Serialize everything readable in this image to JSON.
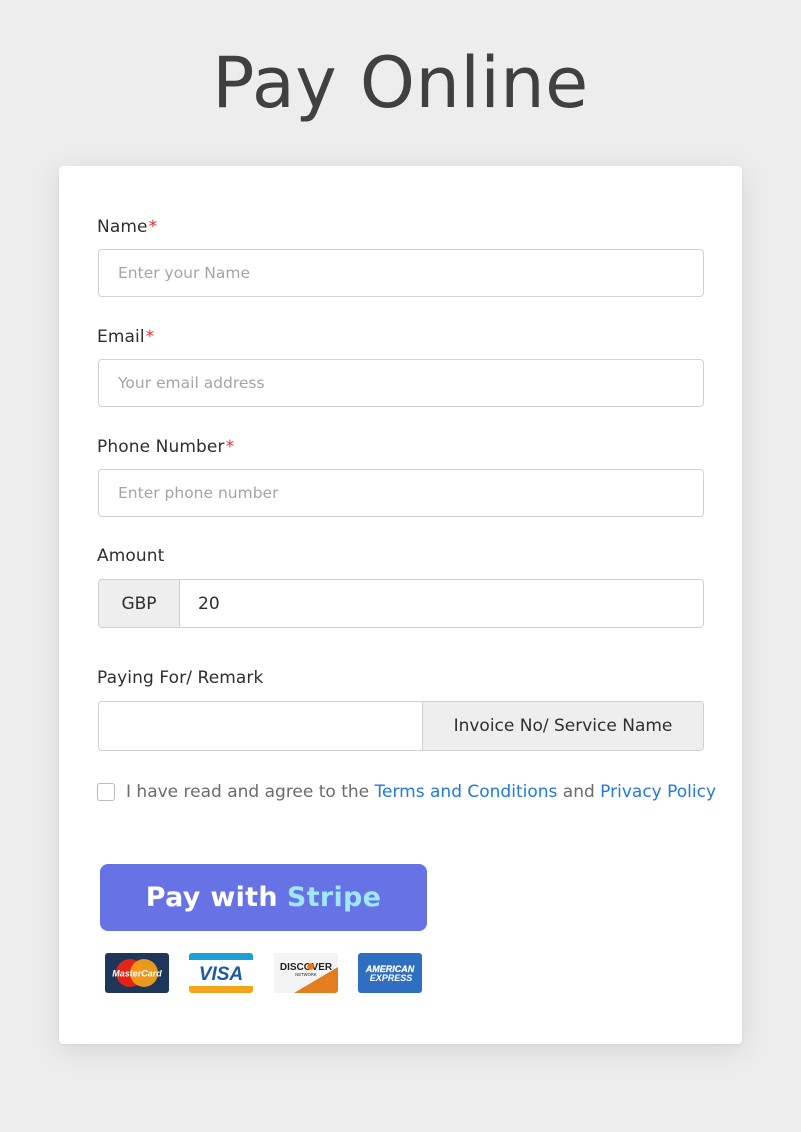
{
  "page": {
    "title": "Pay Online"
  },
  "form": {
    "name": {
      "label": "Name",
      "required_marker": "*",
      "placeholder": "Enter your Name"
    },
    "email": {
      "label": "Email",
      "required_marker": "*",
      "placeholder": "Your email address"
    },
    "phone": {
      "label": "Phone Number",
      "required_marker": "*",
      "placeholder": "Enter phone number"
    },
    "amount": {
      "label": "Amount",
      "currency": "GBP",
      "value": "20"
    },
    "remark": {
      "label": "Paying For/ Remark",
      "value": "",
      "addon": "Invoice No/ Service Name"
    },
    "agreement": {
      "checked": false,
      "prefix": "I have read and agree to the ",
      "terms_link": "Terms and Conditions",
      "joiner": " and ",
      "privacy_link": "Privacy Policy"
    },
    "submit": {
      "label_prefix": "Pay with",
      "label_brand": "Stripe"
    }
  },
  "payment_logos": [
    {
      "name": "mastercard-logo",
      "text": "MasterCard"
    },
    {
      "name": "visa-logo",
      "text": "VISA"
    },
    {
      "name": "discover-logo",
      "text": "DISCOVER",
      "subtext": "NETWORK"
    },
    {
      "name": "amex-logo",
      "text": "AMERICAN",
      "subtext": "EXPRESS"
    }
  ],
  "colors": {
    "background": "#ededed",
    "card": "#ffffff",
    "title": "#404043",
    "required": "#e03030",
    "link": "#1f7ae0",
    "stripe_button": "#6772e5",
    "stripe_accent": "#9fe8fb",
    "addon_bg": "#eeeeef"
  }
}
